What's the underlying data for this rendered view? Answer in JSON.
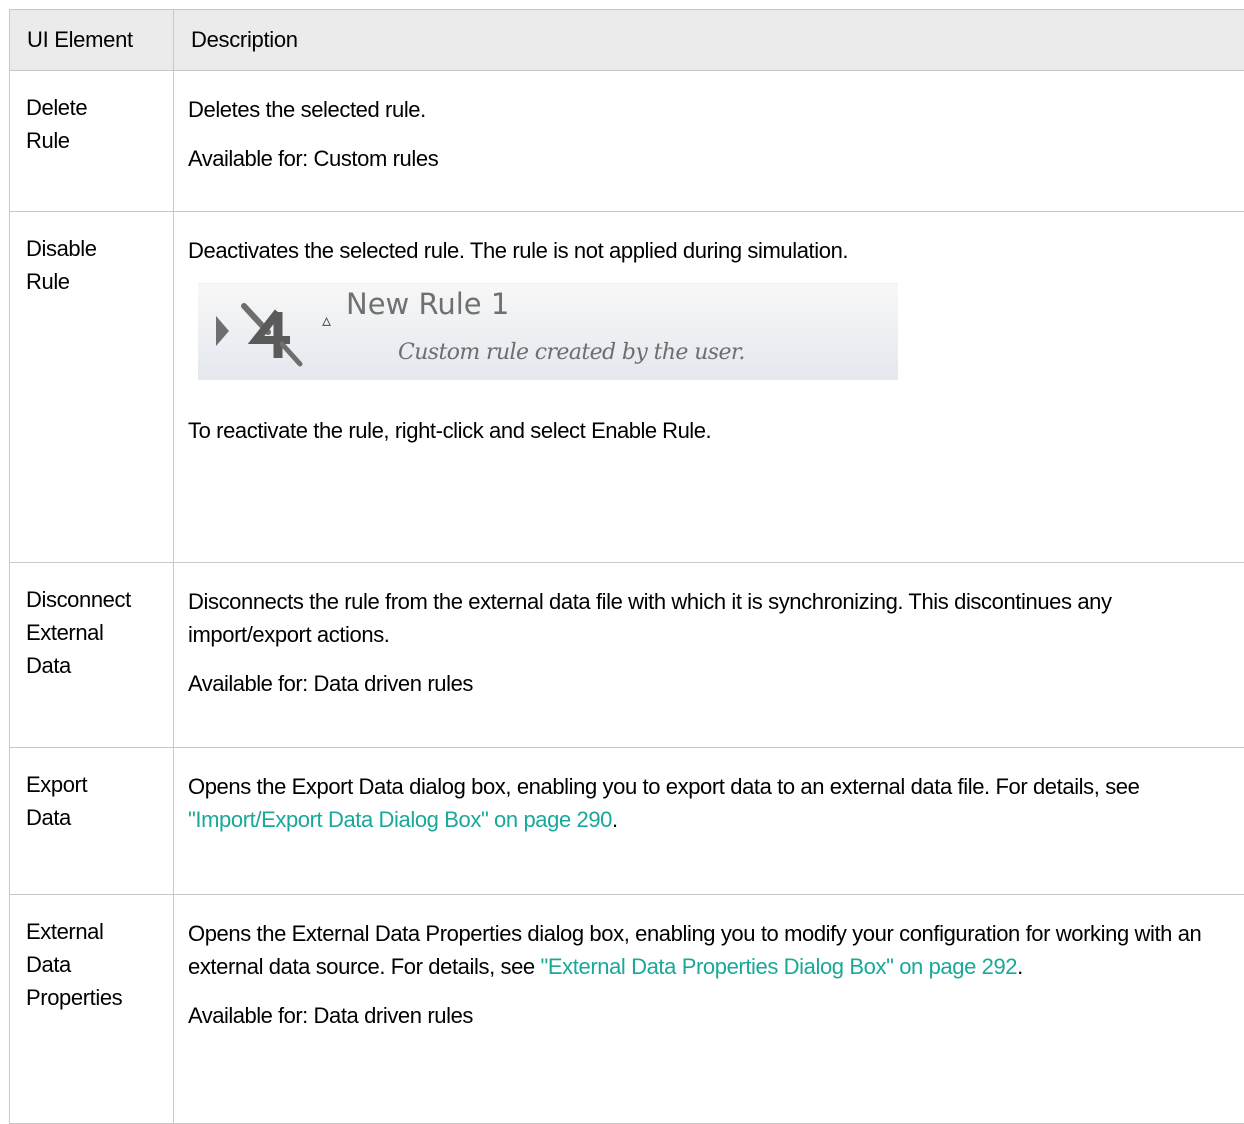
{
  "header": {
    "col_element": "UI Element",
    "col_description": "Description"
  },
  "rows": [
    {
      "element": [
        "Delete",
        "Rule"
      ],
      "description": "Deletes the selected rule.",
      "available_label": "Available for:",
      "available_value": "Custom rules"
    },
    {
      "element": [
        "Disable",
        "Rule"
      ],
      "description": "Deactivates the selected rule. The rule is not applied during simulation.",
      "screenshot": {
        "rule_name": "New Rule 1",
        "rule_desc": "Custom rule created by the user.",
        "warning_glyph": "▵",
        "icons": [
          "play-icon",
          "disabled-rule-icon",
          "warning-icon"
        ]
      },
      "reactivate_text": "To reactivate the rule, right-click and select ",
      "reactivate_bold": "Enable Rule",
      "reactivate_end": "."
    },
    {
      "element": [
        "Disconnect",
        "External",
        "Data"
      ],
      "description": "Disconnects the rule from the external data file with which it is synchronizing. This discontinues any import/export actions.",
      "available_label": "Available for:",
      "available_value": "Data driven rules"
    },
    {
      "element": [
        "Export",
        "Data"
      ],
      "description": "Opens the Export Data dialog box, enabling you to export data to an external data file. For details, see ",
      "link": "\"Import/Export Data Dialog Box\" on page 290",
      "description_end": "."
    },
    {
      "element": [
        "External",
        "Data",
        "Properties"
      ],
      "description": "Opens the External Data Properties dialog box, enabling you to modify your configuration for working with an external data source. For details, see ",
      "link": "\"External Data Properties Dialog Box\" on page 292",
      "description_end": ".",
      "available_label": "Available for:",
      "available_value": "Data driven rules"
    }
  ],
  "colors": {
    "link": "#19a89a",
    "header_bg": "#ebebeb",
    "border": "#c8c8c8"
  }
}
